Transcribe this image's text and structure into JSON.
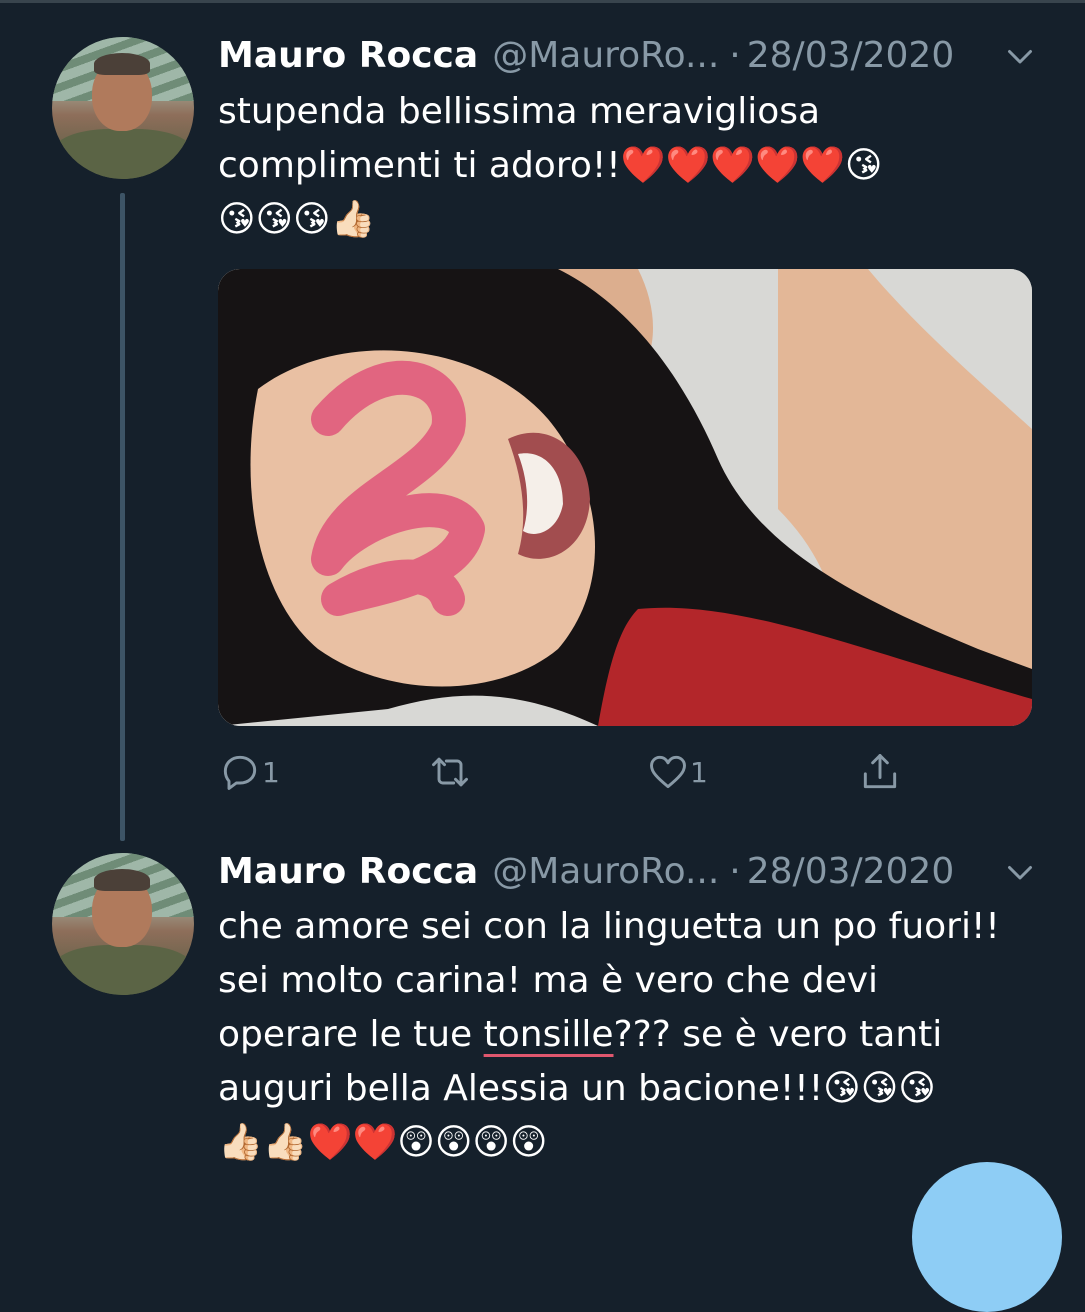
{
  "tweets": [
    {
      "author_name": "Mauro Rocca",
      "handle": "@MauroRo...",
      "separator": "·",
      "date": "28/03/2020",
      "text": "stupenda bellissima meravigliosa complimenti ti adoro!!",
      "emojis_line1": "❤️❤️❤️❤️❤️😘",
      "emojis_line2": "😘😘😘👍🏻",
      "reply_count": "1",
      "like_count": "1"
    },
    {
      "author_name": "Mauro Rocca",
      "handle": "@MauroRo...",
      "separator": "·",
      "date": "28/03/2020",
      "text_line1": "che amore sei con la linguetta un po fuori!!",
      "text_line2": "sei molto carina! ma è vero che devi",
      "text_line3_a": "operare le tue",
      "text_line3_underlined": "tonsille",
      "text_line3_b": "??? se è vero tanti",
      "text_line4": "auguri bella Alessia un bacione!!!",
      "emojis_line4": "😘😘😘",
      "emojis_line5": "👍🏻👍🏻❤️❤️😲😲😲😲"
    }
  ],
  "colors": {
    "background": "#15202b",
    "muted_text": "#8899a6",
    "thread_line": "#3d5466",
    "accent_fab": "#8ecdf5",
    "underline": "#e0576e"
  },
  "icons": [
    "reply-icon",
    "retweet-icon",
    "like-icon",
    "share-icon",
    "chevron-down-icon"
  ]
}
